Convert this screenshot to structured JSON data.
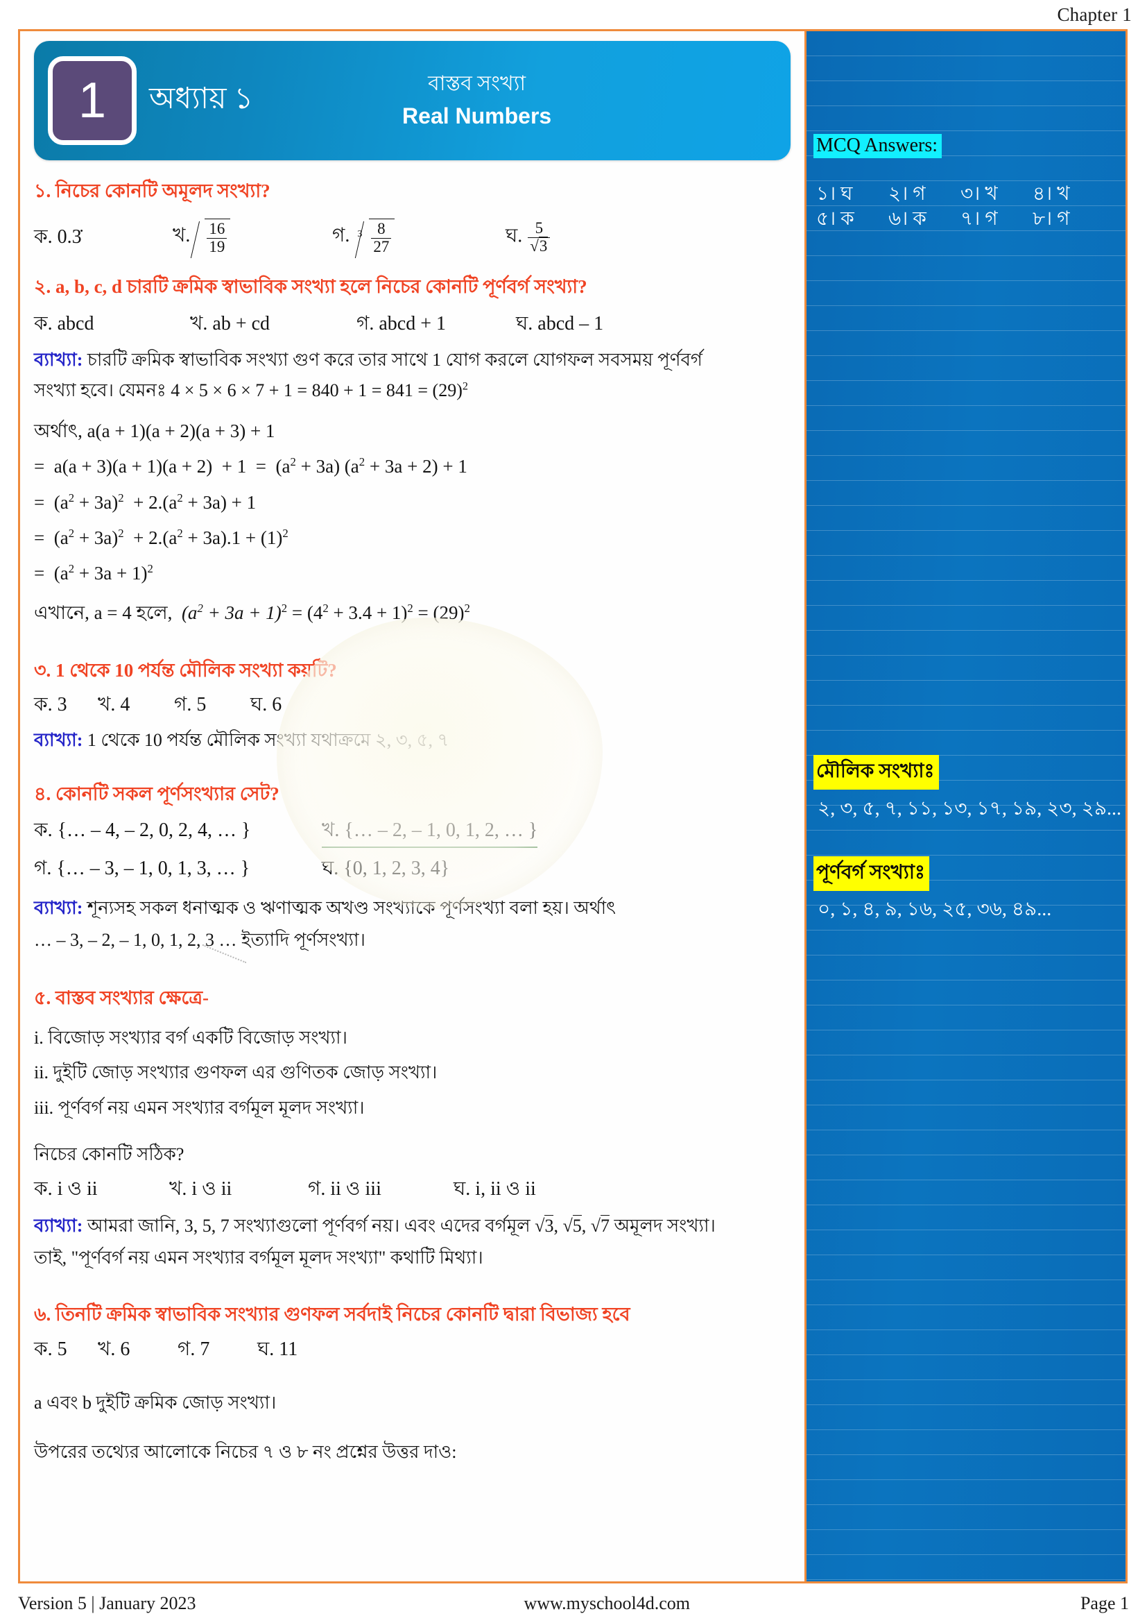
{
  "header": {
    "chapter_label": "Chapter 1"
  },
  "banner": {
    "chapter_number": "1",
    "chapter_bn": "অধ্যায় ১",
    "title_bn": "বাস্তব সংখ্যা",
    "title_en": "Real Numbers",
    "badge_color": "#5b4a79",
    "gradient_from": "#0b7ba8",
    "gradient_to": "#0fa3e6"
  },
  "questions": [
    {
      "number": "১.",
      "title": "নিচের কোনটি অমূলদ সংখ্যা?",
      "options_plain": [
        "ক. 0.3̇",
        "খ. √(16/19)",
        "গ. ³√(8/27)",
        "ঘ. 5/√3"
      ]
    },
    {
      "number": "২.",
      "title_prefix": "২. a, b, c, d",
      "title": "চারটি ক্রমিক স্বাভাবিক সংখ্যা হলে নিচের কোনটি পূর্ণবর্গ সংখ্যা?",
      "options": [
        "ক. abcd",
        "খ. ab + cd",
        "গ. abcd + 1",
        "ঘ. abcd – 1"
      ],
      "expl_label": "ব্যাখ্যা:",
      "expl_line1": "চারটি ক্রমিক স্বাভাবিক সংখ্যা গুণ করে তার সাথে 1 যোগ করলে যোগফল সবসময় পূর্ণবর্গ",
      "expl_line2_pre": "সংখ্যা হবে। যেমনঃ",
      "expl_line2_math": "4 × 5 × 6 × 7 + 1  =  840 + 1  =  841  = (29)",
      "math_lines": {
        "l0_pre": "অর্থাৎ,",
        "l0": "a(a + 1)(a + 2)(a + 3) + 1",
        "l1": "=  a(a + 3)(a + 1)(a + 2)  + 1  =  (a² + 3a) (a² + 3a + 2) + 1",
        "l2": "=  (a² + 3a)² + 2.(a² + 3a) + 1",
        "l3": "=  (a² + 3a)² + 2.(a² + 3a).1 + (1)²",
        "l4": "=  (a² + 3a + 1)²",
        "l5_pre": "এখানে, a  =  4 হলে,",
        "l5": "(a² + 3a + 1)² = (4² + 3.4 + 1)² = (29)²"
      }
    },
    {
      "number": "৩.",
      "title": "৩. 1 থেকে 10 পর্যন্ত মৌলিক সংখ্যা কয়টি?",
      "options": [
        "ক. 3",
        "খ. 4",
        "গ. 5",
        "ঘ. 6"
      ],
      "expl_label": "ব্যাখ্যা:",
      "expl": "1 থেকে 10 পর্যন্ত মৌলিক সংখ্যা যথাক্রমে ২, ৩, ৫, ৭"
    },
    {
      "number": "৪.",
      "title": "৪. কোনটি সকল পূর্ণসংখ্যার সেট?",
      "options": [
        "ক. {… – 4, – 2, 0, 2, 4, … }",
        "খ. {… – 2, – 1, 0, 1, 2, … }",
        "গ. {… – 3, – 1, 0, 1, 3, … }",
        "ঘ. {0, 1, 2, 3, 4}"
      ],
      "expl_label": "ব্যাখ্যা:",
      "expl_line1": "শূন্যসহ সকল ধনাত্মক ও ঋণাত্মক অখণ্ড সংখ্যাকে পূর্ণসংখ্যা বলা হয়। অর্থাৎ",
      "expl_line2": "… – 3, – 2, – 1, 0, 1, 2, 3 … ইত্যাদি পূর্ণসংখ্যা।"
    },
    {
      "number": "৫.",
      "title": "৫. বাস্তব সংখ্যার ক্ষেত্রে-",
      "statements": [
        "i. বিজোড় সংখ্যার বর্গ একটি বিজোড় সংখ্যা।",
        "ii. দুইটি জোড় সংখ্যার গুণফল এর গুণিতক জোড় সংখ্যা।",
        "iii. পূর্ণবর্গ নয় এমন সংখ্যার বর্গমূল মূলদ সংখ্যা।"
      ],
      "prompt": "নিচের কোনটি সঠিক?",
      "options": [
        "ক. i ও ii",
        "খ. i ও ii",
        "গ. ii ও iii",
        "ঘ. i, ii ও ii"
      ],
      "expl_label": "ব্যাখ্যা:",
      "expl_line1_a": "আমরা জানি, 3, 5, 7 সংখ্যাগুলো পূর্ণবর্গ নয়। এবং এদের বর্গমূল",
      "expl_line1_b": "√3, √5, √7 অমূলদ সংখ্যা।",
      "expl_line2": "তাই, \"পূর্ণবর্গ নয় এমন সংখ্যার বর্গমূল মূলদ সংখ্যা\" কথাটি মিথ্যা।"
    },
    {
      "number": "৬.",
      "title": "৬. তিনটি ক্রমিক স্বাভাবিক সংখ্যার গুণফল সর্বদাই নিচের কোনটি দ্বারা বিভাজ্য হবে",
      "options": [
        "ক. 5",
        "খ. 6",
        "গ. 7",
        "ঘ. 11"
      ]
    }
  ],
  "stem": {
    "line1": "a এবং b দুইটি ক্রমিক জোড় সংখ্যা।",
    "line2": "উপরের তথ্যের আলোকে নিচের ৭ ও ৮ নং প্রশ্নের উত্তর দাও:"
  },
  "sidebar": {
    "mcq_heading": "MCQ Answers:",
    "answers_row1": [
      "১। ঘ",
      "২। গ",
      "৩। খ",
      "৪। খ"
    ],
    "answers_row2": [
      "৫। ক",
      "৬। ক",
      "৭। গ",
      "৮। গ"
    ],
    "prime_heading": "মৌলিক সংখ্যাঃ",
    "prime_values": "২, ৩, ৫, ৭, ১১, ১৩, ১৭, ১৯, ২৩, ২৯...",
    "square_heading": "পূর্ণবর্গ সংখ্যাঃ",
    "square_values": "০, ১, ৪, ৯, ১৬, ২৫, ৩৬, ৪৯...",
    "panel_color": "#0b74bf",
    "cyan_highlight": "#12f0ff",
    "yellow_highlight": "#ffff00"
  },
  "footer": {
    "version": "Version 5 | January 2023",
    "website": "www.myschool4d.com",
    "page": "Page 1"
  }
}
